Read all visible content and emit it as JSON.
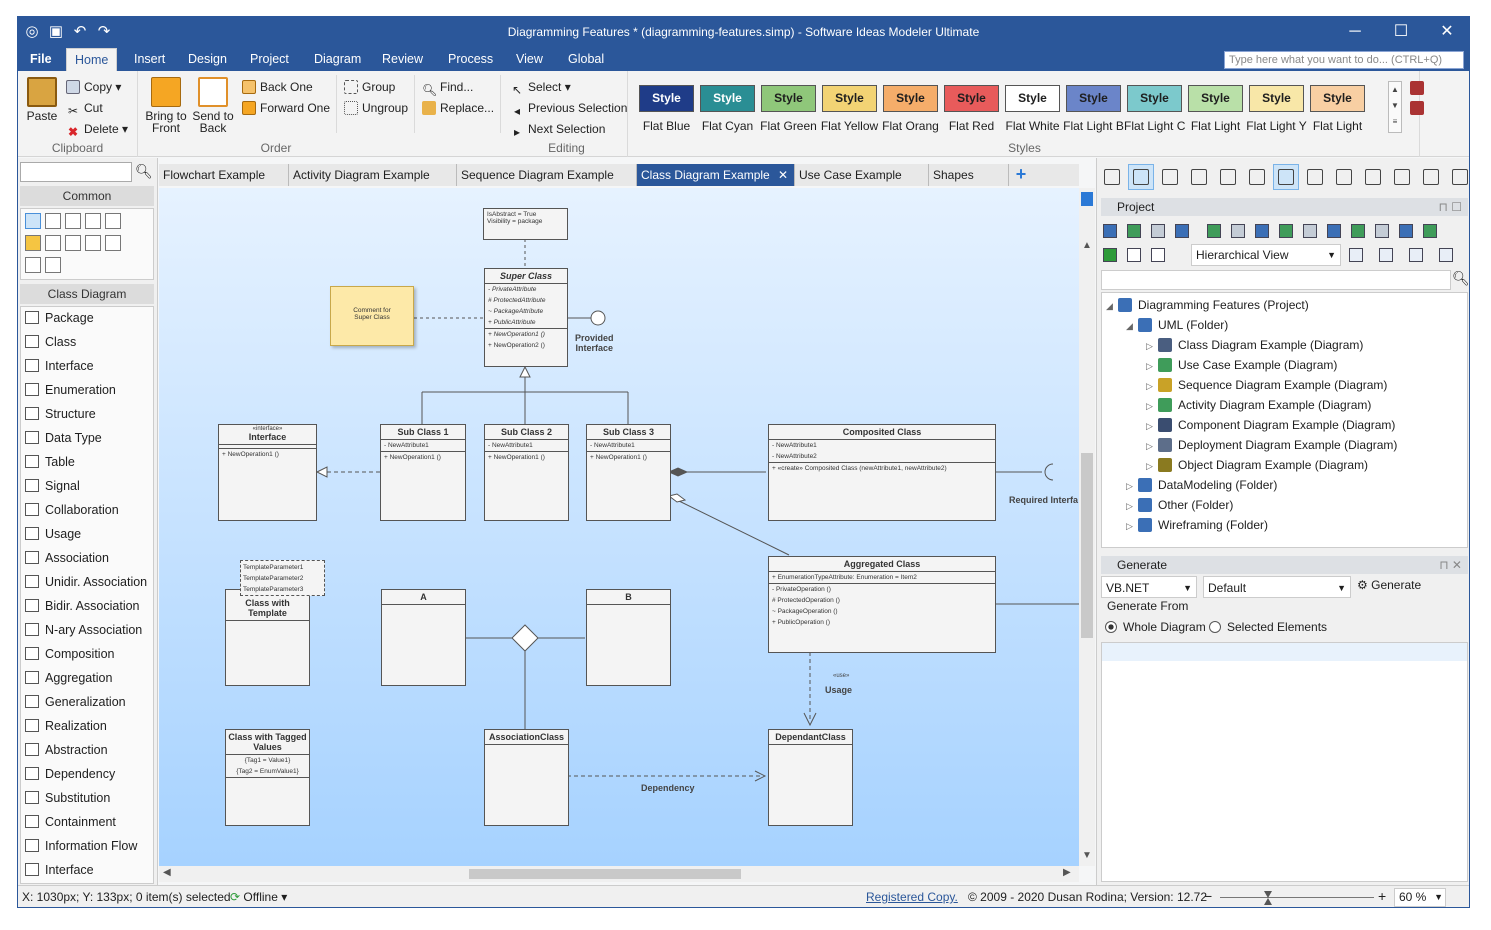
{
  "window": {
    "title": "Diagramming Features * (diagramming-features.simp) - Software Ideas Modeler Ultimate"
  },
  "ribbon": {
    "tabs": [
      "File",
      "Home",
      "Insert",
      "Design",
      "Project",
      "Diagram",
      "Review",
      "Process",
      "View",
      "Global"
    ],
    "search_placeholder": "Type here what you want to do... (CTRL+Q)",
    "clipboard": {
      "paste": "Paste",
      "copy": "Copy",
      "cut": "Cut",
      "delete": "Delete",
      "label": "Clipboard"
    },
    "order": {
      "bring_front": "Bring to Front",
      "send_back": "Send to Back",
      "back_one": "Back One",
      "forward_one": "Forward One",
      "group": "Group",
      "ungroup": "Ungroup",
      "label": "Order"
    },
    "editing": {
      "find": "Find...",
      "replace": "Replace...",
      "select": "Select",
      "prev_sel": "Previous Selection",
      "next_sel": "Next Selection",
      "label": "Editing"
    },
    "styles": {
      "label": "Styles",
      "items": [
        {
          "btn": "Style",
          "name": "Flat Blue",
          "bg": "#1f3c88",
          "fg": "#ffffff"
        },
        {
          "btn": "Style",
          "name": "Flat Cyan",
          "bg": "#2a8e94",
          "fg": "#ffffff"
        },
        {
          "btn": "Style",
          "name": "Flat Green",
          "bg": "#8fc77a",
          "fg": "#1e1e1e"
        },
        {
          "btn": "Style",
          "name": "Flat Yellow",
          "bg": "#f2d374",
          "fg": "#1e1e1e"
        },
        {
          "btn": "Style",
          "name": "Flat Orang",
          "bg": "#f5ad6a",
          "fg": "#1e1e1e"
        },
        {
          "btn": "Style",
          "name": "Flat Red",
          "bg": "#e85b5b",
          "fg": "#1e1e1e"
        },
        {
          "btn": "Style",
          "name": "Flat White",
          "bg": "#ffffff",
          "fg": "#1e1e1e"
        },
        {
          "btn": "Style",
          "name": "Flat Light B",
          "bg": "#6b85c9",
          "fg": "#1e1e1e"
        },
        {
          "btn": "Style",
          "name": "Flat Light C",
          "bg": "#7cc9cc",
          "fg": "#1e1e1e"
        },
        {
          "btn": "Style",
          "name": "Flat Light",
          "bg": "#b9e0a8",
          "fg": "#1e1e1e"
        },
        {
          "btn": "Style",
          "name": "Flat Light Y",
          "bg": "#f8e7a8",
          "fg": "#1e1e1e"
        },
        {
          "btn": "Style",
          "name": "Flat Light",
          "bg": "#f8cfa3",
          "fg": "#1e1e1e"
        }
      ]
    }
  },
  "left": {
    "common": "Common",
    "class_diagram": "Class Diagram",
    "items": [
      "Package",
      "Class",
      "Interface",
      "Enumeration",
      "Structure",
      "Data Type",
      "Table",
      "Signal",
      "Collaboration",
      "Usage",
      "Association",
      "Unidir. Association",
      "Bidir. Association",
      "N-ary Association",
      "Composition",
      "Aggregation",
      "Generalization",
      "Realization",
      "Abstraction",
      "Dependency",
      "Substitution",
      "Containment",
      "Information Flow",
      "Interface"
    ]
  },
  "doc_tabs": [
    "Flowchart Example",
    "Activity Diagram Example",
    "Sequence Diagram Example",
    "Class Diagram Example",
    "Use Case Example",
    "Shapes"
  ],
  "diagram": {
    "note_top": [
      "IsAbstract = True",
      "Visibility = package"
    ],
    "comment": [
      "Comment for",
      "Super Class"
    ],
    "provided": [
      "Provided",
      "Interface"
    ],
    "required": "Required Interfa",
    "super": {
      "name": "Super Class",
      "attrs": [
        "- PrivateAttribute",
        "# ProtectedAttribute",
        "~ PackageAttribute",
        "+ PublicAttribute"
      ],
      "ops": [
        "+ NewOperation1 ()",
        "+ NewOperation2 ()"
      ]
    },
    "interface": {
      "stereo": "«interface»",
      "name": "Interface",
      "ops": [
        "+ NewOperation1 ()"
      ]
    },
    "sub1": {
      "name": "Sub Class 1",
      "attrs": [
        "- NewAttribute1"
      ],
      "ops": [
        "+ NewOperation1 ()"
      ]
    },
    "sub2": {
      "name": "Sub Class  2",
      "attrs": [
        "- NewAttribute1"
      ],
      "ops": [
        "+ NewOperation1 ()"
      ]
    },
    "sub3": {
      "name": "Sub Class 3",
      "attrs": [
        "- NewAttribute1"
      ],
      "ops": [
        "+ NewOperation1 ()"
      ]
    },
    "composited": {
      "name": "Composited Class",
      "attrs": [
        "- NewAttribute1",
        "- NewAttribute2"
      ],
      "ops": [
        "+ «create» Composited Class (newAttribute1, newAttribute2)"
      ]
    },
    "aggregated": {
      "name": "Aggregated Class",
      "attrs": [
        "+ EnumerationTypeAttribute: Enumeration = Item2"
      ],
      "ops": [
        "- PrivateOperation ()",
        "# ProtectedOperation ()",
        "~ PackageOperation ()",
        "+ PublicOperation ()"
      ]
    },
    "template_params": [
      "TemplateParameter1",
      "TemplateParameter2",
      "TemplateParameter3"
    ],
    "template_class": "Class with Template",
    "a": "A",
    "b": "B",
    "tagged": {
      "name": "Class with Tagged Values",
      "tags": [
        "{Tag1 = Value1}",
        "{Tag2 = EnumValue1}"
      ]
    },
    "assoc_class": "AssociationClass",
    "dependant": "DependantClass",
    "usage_stereo": "«use»",
    "usage": "Usage",
    "dependency": "Dependency"
  },
  "right": {
    "project_title": "Project",
    "view": "Hierarchical View",
    "tree": [
      {
        "label": "Diagramming Features (Project)",
        "level": 0,
        "tw": "◢",
        "color": "#3b6fb6"
      },
      {
        "label": "UML (Folder)",
        "level": 1,
        "tw": "◢",
        "color": "#3b6fb6"
      },
      {
        "label": "Class Diagram Example (Diagram)",
        "level": 2,
        "tw": "▷",
        "color": "#4a5e80"
      },
      {
        "label": "Use Case Example (Diagram)",
        "level": 2,
        "tw": "▷",
        "color": "#3f9c5a"
      },
      {
        "label": "Sequence Diagram Example (Diagram)",
        "level": 2,
        "tw": "▷",
        "color": "#c9a227"
      },
      {
        "label": "Activity Diagram Example (Diagram)",
        "level": 2,
        "tw": "▷",
        "color": "#3f9c5a"
      },
      {
        "label": "Component Diagram Example (Diagram)",
        "level": 2,
        "tw": "▷",
        "color": "#3a4d70"
      },
      {
        "label": "Deployment Diagram Example (Diagram)",
        "level": 2,
        "tw": "▷",
        "color": "#5d6e8a"
      },
      {
        "label": "Object Diagram Example (Diagram)",
        "level": 2,
        "tw": "▷",
        "color": "#8a7a20"
      },
      {
        "label": "DataModeling (Folder)",
        "level": 1,
        "tw": "▷",
        "color": "#3b6fb6"
      },
      {
        "label": "Other (Folder)",
        "level": 1,
        "tw": "▷",
        "color": "#3b6fb6"
      },
      {
        "label": "Wireframing (Folder)",
        "level": 1,
        "tw": "▷",
        "color": "#3b6fb6"
      }
    ],
    "generate": {
      "title": "Generate",
      "lang": "VB.NET",
      "profile": "Default",
      "btn": "Generate",
      "from": "Generate From",
      "whole": "Whole Diagram",
      "selected": "Selected Elements"
    }
  },
  "status": {
    "coords": "X: 1030px; Y: 133px; 0 item(s) selected",
    "offline": "Offline",
    "registered": "Registered Copy.",
    "copyright": "© 2009 - 2020 Dusan Rodina; Version: 12.72",
    "zoom": "60 %"
  }
}
